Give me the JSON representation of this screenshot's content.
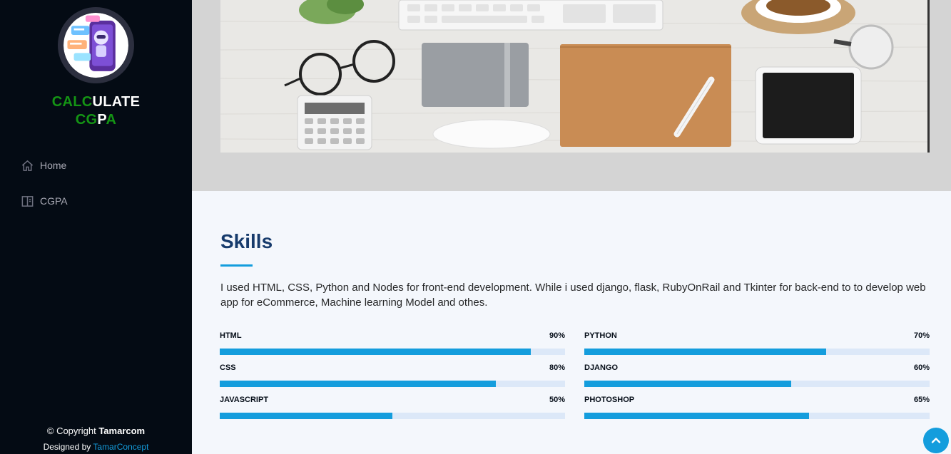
{
  "sidebar": {
    "brand_line1_green": "CALC",
    "brand_line1_white": "ULATE",
    "brand_line2_green1": "CG",
    "brand_line2_white": "P",
    "brand_line2_green2": "A",
    "nav": [
      {
        "label": "Home",
        "icon": "home-icon"
      },
      {
        "label": "CGPA",
        "icon": "book-icon"
      }
    ],
    "footer": {
      "copyright_prefix": "© Copyright ",
      "copyright_owner": "Tamarcom",
      "designed_by_prefix": "Designed by ",
      "designer_link": "TamarConcept"
    }
  },
  "skills": {
    "title": "Skills",
    "description": "I used HTML, CSS, Python and Nodes for front-end development. While i used django, flask, RubyOnRail and Tkinter for back-end to to develop web app for eCommerce, Machine learning Model and othes.",
    "items": [
      {
        "name": "HTML",
        "percent_label": "90%",
        "value": 0.9
      },
      {
        "name": "PYTHON",
        "percent_label": "70%",
        "value": 0.7
      },
      {
        "name": "CSS",
        "percent_label": "80%",
        "value": 0.8
      },
      {
        "name": "DJANGO",
        "percent_label": "60%",
        "value": 0.6
      },
      {
        "name": "JAVASCRIPT",
        "percent_label": "50%",
        "value": 0.5
      },
      {
        "name": "PHOTOSHOP",
        "percent_label": "65%",
        "value": 0.65
      }
    ]
  },
  "colors": {
    "sidebar_bg": "#040b14",
    "accent": "#149ddd",
    "brand_green": "#149414",
    "title_blue": "#173b6c"
  },
  "icons": {
    "back_to_top": "chevron-up-icon"
  }
}
